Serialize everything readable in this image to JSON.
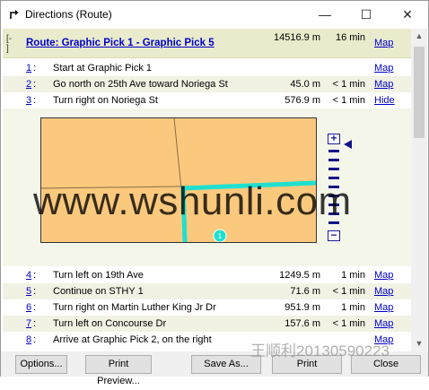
{
  "window": {
    "title": "Directions (Route)",
    "controls": {
      "minimize": "—",
      "maximize": "☐",
      "close": "✕"
    }
  },
  "route": {
    "collapse_glyph": "[-\n]",
    "title": "Route: Graphic Pick 1 - Graphic Pick 5",
    "distance": "14516.9 m",
    "time": "16 min",
    "action": "Map"
  },
  "steps_top": [
    {
      "num": "1",
      "desc": "Start at Graphic Pick 1",
      "dist": "",
      "time": "",
      "action": "Map"
    },
    {
      "num": "2",
      "desc": "Go north on 25th Ave toward Noriega St",
      "dist": "45.0 m",
      "time": "< 1 min",
      "action": "Map"
    },
    {
      "num": "3",
      "desc": "Turn right on Noriega St",
      "dist": "576.9 m",
      "time": "< 1 min",
      "action": "Hide"
    }
  ],
  "steps_bottom": [
    {
      "num": "4",
      "desc": "Turn left on 19th Ave",
      "dist": "1249.5 m",
      "time": "1 min",
      "action": "Map"
    },
    {
      "num": "5",
      "desc": "Continue on STHY 1",
      "dist": "71.6 m",
      "time": "< 1 min",
      "action": "Map"
    },
    {
      "num": "6",
      "desc": "Turn right on Martin Luther King Jr Dr",
      "dist": "951.9 m",
      "time": "1 min",
      "action": "Map"
    },
    {
      "num": "7",
      "desc": "Turn left on Concourse Dr",
      "dist": "157.6 m",
      "time": "< 1 min",
      "action": "Map"
    },
    {
      "num": "8",
      "desc": "Arrive at Graphic Pick 2, on the right",
      "dist": "",
      "time": "",
      "action": "Map"
    }
  ],
  "map": {
    "zoom_plus": "+",
    "zoom_minus": "−",
    "stop_label": "1",
    "colors": {
      "land": "#fbc97d",
      "route": "#1fe0d0",
      "zoom": "#14148a"
    }
  },
  "scrollbar": {
    "up": "▲",
    "down": "▼"
  },
  "buttons": {
    "options": "Options...",
    "print_preview": "Print Preview...",
    "save_as": "Save As...",
    "print": "Print",
    "close": "Close"
  },
  "watermark": {
    "main": "www.wshunli.com",
    "corner": "王顺利20130590223"
  }
}
